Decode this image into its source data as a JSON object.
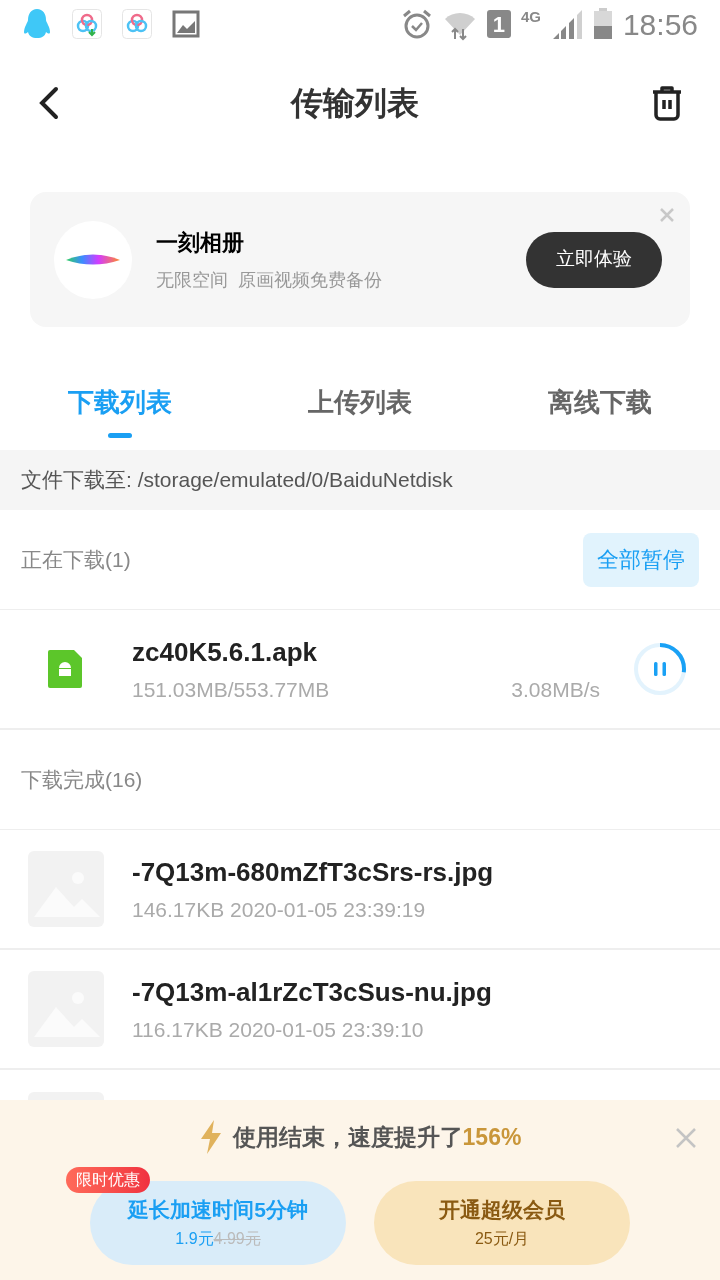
{
  "status_bar": {
    "sim_slot": "1",
    "network": "4G",
    "time": "18:56"
  },
  "header": {
    "title": "传输列表"
  },
  "promo": {
    "title": "一刻相册",
    "subtitle": "无限空间  原画视频免费备份",
    "button": "立即体验"
  },
  "tabs": [
    {
      "label": "下载列表",
      "selected": true
    },
    {
      "label": "上传列表",
      "selected": false
    },
    {
      "label": "离线下载",
      "selected": false
    }
  ],
  "path": "文件下载至: /storage/emulated/0/BaiduNetdisk",
  "downloading": {
    "heading": "正在下载(1)",
    "button": "全部暂停",
    "items": [
      {
        "name": "zc40K5.6.1.apk",
        "size": "151.03MB/553.77MB",
        "speed": "3.08MB/s"
      }
    ]
  },
  "completed": {
    "heading": "下载完成(16)",
    "items": [
      {
        "name": "-7Q13m-680mZfT3cSrs-rs.jpg",
        "meta": "146.17KB 2020-01-05 23:39:19"
      },
      {
        "name": "-7Q13m-al1rZcT3cSus-nu.jpg",
        "meta": "116.17KB 2020-01-05 23:39:10"
      }
    ]
  },
  "speed_panel": {
    "message": "使用结束，速度提升了",
    "highlight": "156%",
    "badge": "限时优惠",
    "offers": [
      {
        "kind": "extend",
        "title": "延长加速时间5分钟",
        "price": "1.9元",
        "old_price": "4.99元"
      },
      {
        "kind": "vip",
        "title": "开通超级会员",
        "price": "25元/月"
      }
    ]
  }
}
